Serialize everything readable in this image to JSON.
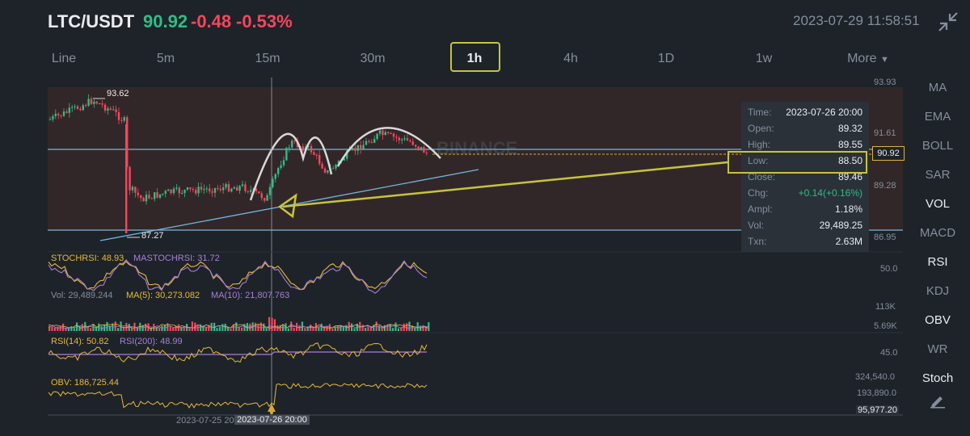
{
  "header": {
    "pair": "LTC/USDT",
    "last_price": "90.92",
    "change_abs": "-0.48",
    "change_pct": "-0.53%",
    "datetime": "2023-07-29 11:58:51",
    "collapse_icon": "collapse-arrows-icon"
  },
  "intervals": {
    "items": [
      "Line",
      "5m",
      "15m",
      "30m",
      "1h",
      "4h",
      "1D",
      "1w",
      "More"
    ],
    "active": "1h",
    "more_icon": "caret-down-icon"
  },
  "side_menu": {
    "items": [
      "MA",
      "EMA",
      "BOLL",
      "SAR",
      "VOL",
      "MACD",
      "RSI",
      "KDJ",
      "OBV",
      "WR",
      "Stoch"
    ],
    "active": [
      "VOL",
      "RSI",
      "OBV",
      "Stoch"
    ],
    "edit_icon": "pencil-icon"
  },
  "main_chart": {
    "price_axis": [
      "93.93",
      "91.61",
      "89.28",
      "86.95"
    ],
    "high_marker": "93.62",
    "low_marker": "87.27",
    "current_price_tag": "90.92",
    "watermark": "BINANCE",
    "colors": {
      "up": "#2ebd85",
      "down": "#f6465d",
      "annotation": "#c8c43a",
      "trendline": "#6fb7e0"
    }
  },
  "tooltip": {
    "rows": [
      {
        "k": "Time:",
        "v": "2023-07-26 20:00"
      },
      {
        "k": "Open:",
        "v": "89.32"
      },
      {
        "k": "High:",
        "v": "89.55"
      },
      {
        "k": "Low:",
        "v": "88.50"
      },
      {
        "k": "Close:",
        "v": "89.46"
      },
      {
        "k": "Chg:",
        "v": "+0.14(+0.16%)"
      },
      {
        "k": "Ampl:",
        "v": "1.18%"
      },
      {
        "k": "Vol:",
        "v": "29,489.25"
      },
      {
        "k": "Txn:",
        "v": "2.63M"
      }
    ]
  },
  "stochrsi": {
    "label1": "STOCHRSI: 48.93",
    "label2": "MASTOCHRSI: 31.72",
    "axis": "50.0"
  },
  "volume": {
    "label1": "Vol: 29,489.244",
    "label2": "MA(5): 30,273.082",
    "label3": "MA(10): 21,807.763",
    "axis_top": "113K",
    "axis_bottom": "5.69K"
  },
  "rsi": {
    "label1": "RSI(14): 50.82",
    "label2": "RSI(200): 48.99",
    "axis": "45.0"
  },
  "obv": {
    "label1": "OBV: 186,725.44",
    "axis1": "324,540.0",
    "axis2": "193,890.0",
    "axis3": "95,977.20"
  },
  "time_axis": {
    "left": "2023-07-25 20",
    "cursor": "2023-07-26 20:00"
  }
}
